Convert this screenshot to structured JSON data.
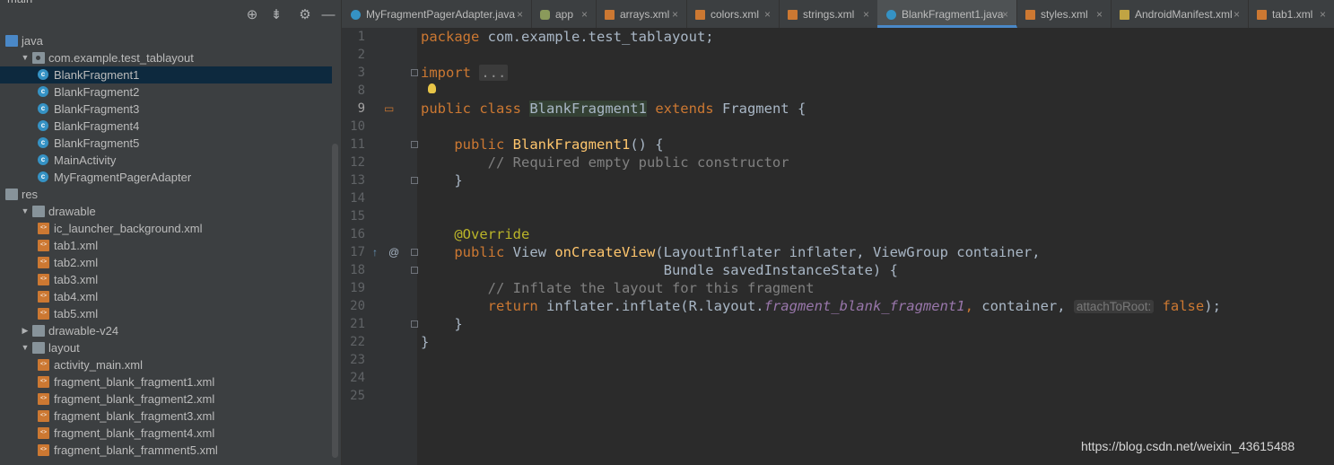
{
  "sidebar": {
    "peek_top": "main",
    "peek_bottom": "...",
    "tree": [
      {
        "label": "java",
        "indent": 0,
        "icon": "folder-blue-icon",
        "arrow": ""
      },
      {
        "label": "com.example.test_tablayout",
        "indent": 1,
        "icon": "package-icon",
        "arrow": "▼"
      },
      {
        "label": "BlankFragment1",
        "indent": 2,
        "icon": "class-icon",
        "arrow": "",
        "selected": true
      },
      {
        "label": "BlankFragment2",
        "indent": 2,
        "icon": "class-icon",
        "arrow": ""
      },
      {
        "label": "BlankFragment3",
        "indent": 2,
        "icon": "class-icon",
        "arrow": ""
      },
      {
        "label": "BlankFragment4",
        "indent": 2,
        "icon": "class-icon",
        "arrow": ""
      },
      {
        "label": "BlankFragment5",
        "indent": 2,
        "icon": "class-icon",
        "arrow": ""
      },
      {
        "label": "MainActivity",
        "indent": 2,
        "icon": "class-icon",
        "arrow": ""
      },
      {
        "label": "MyFragmentPagerAdapter",
        "indent": 2,
        "icon": "class-icon",
        "arrow": ""
      },
      {
        "label": "res",
        "indent": 0,
        "icon": "folder-icon",
        "arrow": ""
      },
      {
        "label": "drawable",
        "indent": 1,
        "icon": "folder-icon",
        "arrow": "▼"
      },
      {
        "label": "ic_launcher_background.xml",
        "indent": 2,
        "icon": "xml-file-icon",
        "arrow": ""
      },
      {
        "label": "tab1.xml",
        "indent": 2,
        "icon": "xml-file-icon",
        "arrow": ""
      },
      {
        "label": "tab2.xml",
        "indent": 2,
        "icon": "xml-file-icon",
        "arrow": ""
      },
      {
        "label": "tab3.xml",
        "indent": 2,
        "icon": "xml-file-icon",
        "arrow": ""
      },
      {
        "label": "tab4.xml",
        "indent": 2,
        "icon": "xml-file-icon",
        "arrow": ""
      },
      {
        "label": "tab5.xml",
        "indent": 2,
        "icon": "xml-file-icon",
        "arrow": ""
      },
      {
        "label": "drawable-v24",
        "indent": 1,
        "icon": "folder-icon",
        "arrow": "▶"
      },
      {
        "label": "layout",
        "indent": 1,
        "icon": "folder-icon",
        "arrow": "▼"
      },
      {
        "label": "activity_main.xml",
        "indent": 2,
        "icon": "xml-file-icon",
        "arrow": ""
      },
      {
        "label": "fragment_blank_fragment1.xml",
        "indent": 2,
        "icon": "xml-file-icon",
        "arrow": ""
      },
      {
        "label": "fragment_blank_fragment2.xml",
        "indent": 2,
        "icon": "xml-file-icon",
        "arrow": ""
      },
      {
        "label": "fragment_blank_fragment3.xml",
        "indent": 2,
        "icon": "xml-file-icon",
        "arrow": ""
      },
      {
        "label": "fragment_blank_fragment4.xml",
        "indent": 2,
        "icon": "xml-file-icon",
        "arrow": ""
      },
      {
        "label": "fragment_blank_framment5.xml",
        "indent": 2,
        "icon": "xml-file-icon",
        "arrow": ""
      }
    ]
  },
  "toolbar": {
    "locate_icon": "⊕",
    "collapse_icon": "⇟",
    "settings_icon": "⚙",
    "hide_icon": "—"
  },
  "tabs": [
    {
      "label": "MyFragmentPagerAdapter.java",
      "icon": "cls-i",
      "active": false
    },
    {
      "label": "app",
      "icon": "app-i",
      "active": false
    },
    {
      "label": "arrays.xml",
      "icon": "xml-i",
      "active": false
    },
    {
      "label": "colors.xml",
      "icon": "xml-i",
      "active": false
    },
    {
      "label": "strings.xml",
      "icon": "xml-i",
      "active": false
    },
    {
      "label": "BlankFragment1.java",
      "icon": "cls-i",
      "active": true
    },
    {
      "label": "styles.xml",
      "icon": "xml-i",
      "active": false
    },
    {
      "label": "AndroidManifest.xml",
      "icon": "man-i",
      "active": false
    },
    {
      "label": "tab1.xml",
      "icon": "xml-i",
      "active": false
    }
  ],
  "editor": {
    "line_numbers": [
      "1",
      "2",
      "3",
      "8",
      "9",
      "10",
      "11",
      "12",
      "13",
      "14",
      "15",
      "16",
      "17",
      "18",
      "19",
      "20",
      "21",
      "22",
      "23",
      "24",
      "25"
    ],
    "current_line": "9",
    "lines": [
      [
        [
          "kw",
          "package "
        ],
        [
          "",
          "com.example.test_tablayout;"
        ]
      ],
      [],
      [
        [
          "kw",
          "import "
        ],
        [
          "fold-ellipsis",
          "..."
        ]
      ],
      [],
      [
        [
          "kw",
          "public class "
        ],
        [
          "classname",
          "BlankFragment1"
        ],
        [
          "kw",
          " extends "
        ],
        [
          "",
          "Fragment {"
        ]
      ],
      [],
      [
        [
          "",
          "    "
        ],
        [
          "kw",
          "public "
        ],
        [
          "fn",
          "BlankFragment1"
        ],
        [
          "",
          "() {"
        ]
      ],
      [
        [
          "",
          "        "
        ],
        [
          "cm",
          "// Required empty public constructor"
        ]
      ],
      [
        [
          "",
          "    }"
        ]
      ],
      [],
      [],
      [
        [
          "",
          "    "
        ],
        [
          "ann",
          "@Override"
        ]
      ],
      [
        [
          "",
          "    "
        ],
        [
          "kw",
          "public "
        ],
        [
          "",
          "View "
        ],
        [
          "fn",
          "onCreateView"
        ],
        [
          "",
          "(LayoutInflater inflater, ViewGroup container,"
        ]
      ],
      [
        [
          "",
          "                             Bundle savedInstanceState) {"
        ]
      ],
      [
        [
          "",
          "        "
        ],
        [
          "cm",
          "// Inflate the layout for this fragment"
        ]
      ],
      [
        [
          "",
          "        "
        ],
        [
          "kw",
          "return "
        ],
        [
          "",
          "inflater.inflate(R.layout."
        ],
        [
          "it",
          "fragment_blank_fragment1"
        ],
        [
          "kw",
          ", "
        ],
        [
          "",
          "container, "
        ],
        [
          "hint",
          "attachToRoot:"
        ],
        [
          "kw",
          " false"
        ],
        [
          "",
          ");"
        ]
      ],
      [
        [
          "",
          "    }"
        ]
      ],
      [
        [
          "",
          "}"
        ]
      ],
      [],
      [],
      []
    ]
  },
  "watermark": "https://blog.csdn.net/weixin_43615488"
}
